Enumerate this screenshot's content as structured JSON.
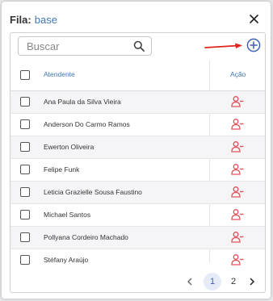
{
  "dialog": {
    "title_prefix": "Fila:",
    "title_name": "base"
  },
  "search": {
    "placeholder": "Buscar"
  },
  "table": {
    "columns": [
      "Atendente",
      "Ação"
    ],
    "rows": [
      {
        "name": "Ana Paula da Silva Vieira"
      },
      {
        "name": "Anderson Do Carmo Ramos"
      },
      {
        "name": "Ewerton Oliveira"
      },
      {
        "name": "Felipe Funk"
      },
      {
        "name": "Leticia Grazielle Sousa Faustino"
      },
      {
        "name": "Michael Santos"
      },
      {
        "name": "Pollyana Cordeiro Machado"
      },
      {
        "name": "Stéfany Araújo"
      }
    ]
  },
  "pagination": {
    "pages": [
      "1",
      "2"
    ],
    "current_page": "1"
  },
  "colors": {
    "accent": "#3f5fb0",
    "remove": "#e0525c",
    "arrow": "#e0251f"
  },
  "icons": [
    "close-icon",
    "search-icon",
    "add-circle-icon",
    "user-remove-icon",
    "chevron-left-icon",
    "chevron-right-icon"
  ]
}
